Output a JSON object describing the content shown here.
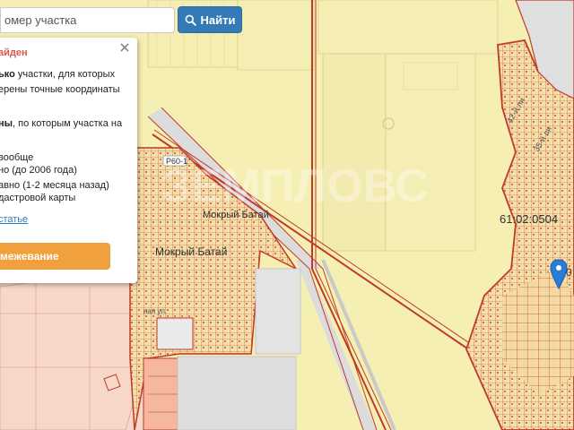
{
  "search": {
    "placeholder": "омер участка"
  },
  "find_button": {
    "label": "Найти",
    "icon": "search-icon"
  },
  "info_popup": {
    "title": "айден",
    "close_icon": "close-icon",
    "line1_bold": "ько",
    "line1_rest": " участки, для которых",
    "line2": "ерены точные координаты",
    "line3_bold": "ны",
    "line3_rest": ", по которым участка на",
    "line4": "вообще",
    "line5": "но (до 2006 года)",
    "line6": "авно (1-2 месяца назад)",
    "line7": "дастровой карты",
    "link": "статье",
    "order_button": "межевание"
  },
  "map": {
    "labels": {
      "settlement_1": "Мокрый Батай",
      "settlement_2": "Мокрый Батай",
      "road_sign": "Р60-1",
      "cadastral_number": "61:02:0504",
      "street_1": "42-й ли",
      "street_2": "35-й ли",
      "street_3": "ная ул.",
      "marker_label": "0"
    },
    "watermark": "ЗЕМПЛОВС",
    "colors": {
      "field": "#f6efb4",
      "boundary": "#c0392b",
      "road": "#dcdcdc",
      "pink_zone": "#f7d3c8",
      "marker": "#2b7bd8",
      "link": "#337ab7",
      "button_primary": "#337ab7",
      "button_order": "#f0a03c",
      "popup_title": "#d9534f"
    }
  }
}
